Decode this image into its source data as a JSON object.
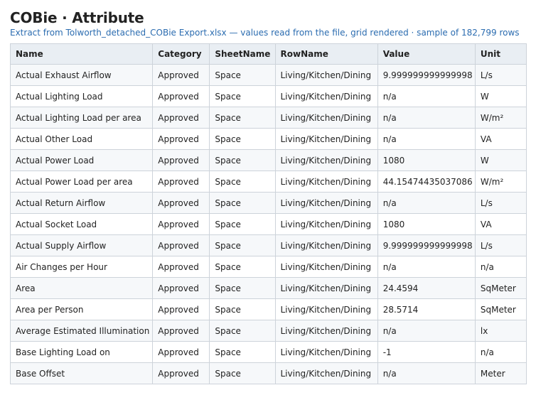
{
  "title": "COBie · Attribute",
  "subtitle": "Extract from Tolworth_detached_COBie Export.xlsx — values read from the file, grid rendered · sample of 182,799 rows",
  "columns": [
    "Name",
    "Category",
    "SheetName",
    "RowName",
    "Value",
    "Unit"
  ],
  "rows": [
    [
      "Actual Exhaust Airflow",
      "Approved",
      "Space",
      "Living/Kitchen/Dining",
      "9.999999999999998",
      "L/s"
    ],
    [
      "Actual Lighting Load",
      "Approved",
      "Space",
      "Living/Kitchen/Dining",
      "n/a",
      "W"
    ],
    [
      "Actual Lighting Load per area",
      "Approved",
      "Space",
      "Living/Kitchen/Dining",
      "n/a",
      "W/m²"
    ],
    [
      "Actual Other Load",
      "Approved",
      "Space",
      "Living/Kitchen/Dining",
      "n/a",
      "VA"
    ],
    [
      "Actual Power Load",
      "Approved",
      "Space",
      "Living/Kitchen/Dining",
      "1080",
      "W"
    ],
    [
      "Actual Power Load per area",
      "Approved",
      "Space",
      "Living/Kitchen/Dining",
      "44.15474435037086",
      "W/m²"
    ],
    [
      "Actual Return Airflow",
      "Approved",
      "Space",
      "Living/Kitchen/Dining",
      "n/a",
      "L/s"
    ],
    [
      "Actual Socket Load",
      "Approved",
      "Space",
      "Living/Kitchen/Dining",
      "1080",
      "VA"
    ],
    [
      "Actual Supply Airflow",
      "Approved",
      "Space",
      "Living/Kitchen/Dining",
      "9.999999999999998",
      "L/s"
    ],
    [
      "Air Changes per Hour",
      "Approved",
      "Space",
      "Living/Kitchen/Dining",
      "n/a",
      "n/a"
    ],
    [
      "Area",
      "Approved",
      "Space",
      "Living/Kitchen/Dining",
      "24.4594",
      "SqMeter"
    ],
    [
      "Area per Person",
      "Approved",
      "Space",
      "Living/Kitchen/Dining",
      "28.5714",
      "SqMeter"
    ],
    [
      "Average Estimated Illumination",
      "Approved",
      "Space",
      "Living/Kitchen/Dining",
      "n/a",
      "lx"
    ],
    [
      "Base Lighting Load on",
      "Approved",
      "Space",
      "Living/Kitchen/Dining",
      "-1",
      "n/a"
    ],
    [
      "Base Offset",
      "Approved",
      "Space",
      "Living/Kitchen/Dining",
      "n/a",
      "Meter"
    ]
  ]
}
